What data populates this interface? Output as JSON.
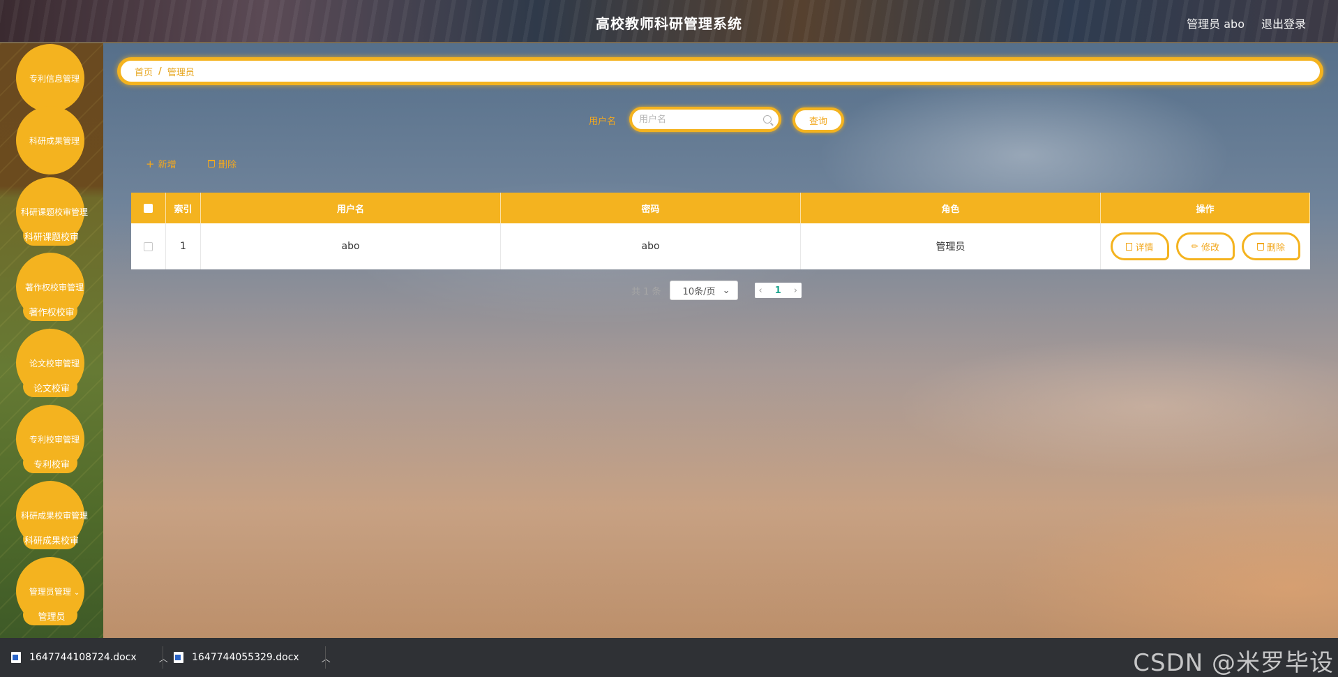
{
  "header": {
    "title": "高校教师科研管理系统",
    "user_label": "管理员 abo",
    "logout_label": "退出登录"
  },
  "sidebar": {
    "menus": [
      {
        "label": "专利信息管理"
      },
      {
        "label": "科研成果管理"
      },
      {
        "label": "科研课题校审管理",
        "sub": "科研课题校审"
      },
      {
        "label": "著作权校审管理",
        "sub": "著作权校审"
      },
      {
        "label": "论文校审管理",
        "sub": "论文校审"
      },
      {
        "label": "专利校审管理",
        "sub": "专利校审"
      },
      {
        "label": "科研成果校审管理",
        "sub": "科研成果校审"
      },
      {
        "label": "管理员管理",
        "sub": "管理员"
      }
    ]
  },
  "breadcrumb": {
    "home": "首页",
    "separator": "/",
    "current": "管理员"
  },
  "search": {
    "label": "用户名",
    "placeholder": "用户名",
    "button": "查询"
  },
  "actions": {
    "add": "新增",
    "delete": "删除"
  },
  "table": {
    "columns": [
      "索引",
      "用户名",
      "密码",
      "角色",
      "操作"
    ],
    "rows": [
      {
        "index": "1",
        "username": "abo",
        "password": "abo",
        "role": "管理员"
      }
    ],
    "row_actions": {
      "detail": "详情",
      "edit": "修改",
      "delete": "删除"
    }
  },
  "pagination": {
    "total": "共 1 条",
    "page_size": "10条/页",
    "current_page": "1"
  },
  "downloads": [
    {
      "name": "1647744108724.docx"
    },
    {
      "name": "1647744055329.docx"
    }
  ],
  "watermark": "CSDN @米罗毕设",
  "colors": {
    "accent": "#f4b31f",
    "accent_text": "#f2a81f",
    "download_bar": "#2f3135"
  }
}
